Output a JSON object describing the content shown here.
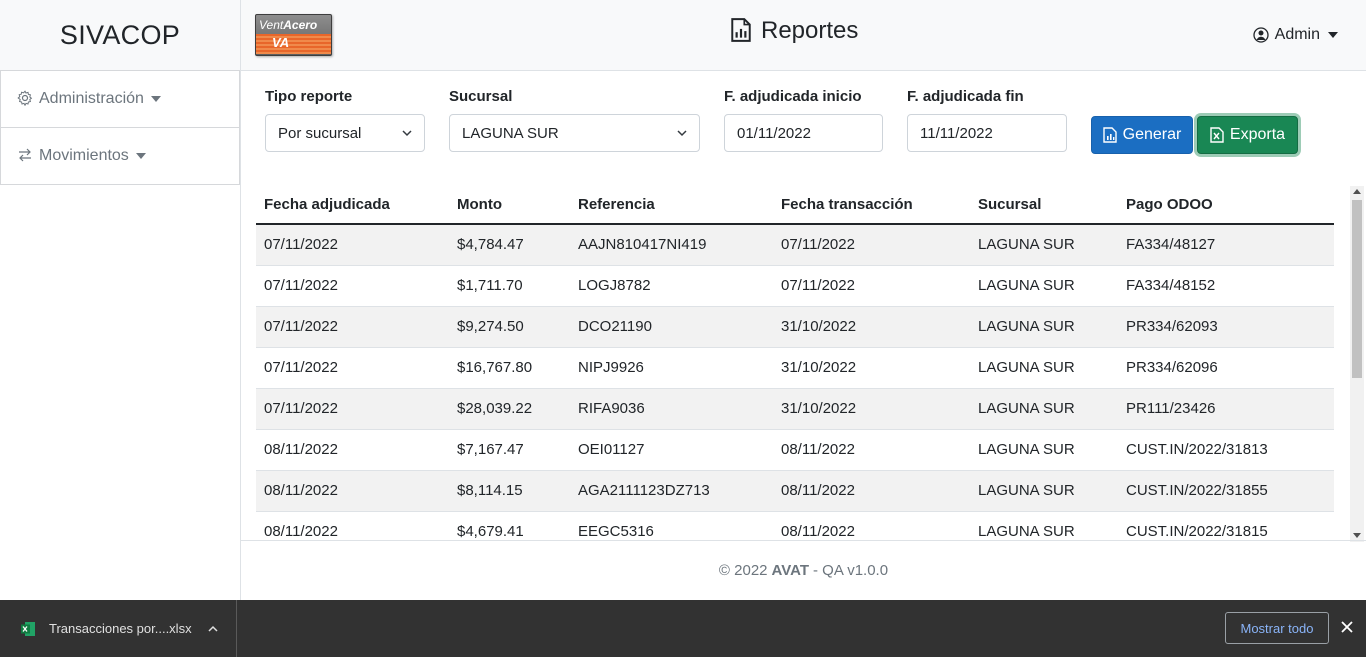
{
  "app": {
    "brand": "SIVACOP",
    "page_title": "Reportes",
    "user": "Admin"
  },
  "logo": {
    "line1_a": "Vent",
    "line1_b": "Acero",
    "line2": "VA"
  },
  "sidebar": {
    "items": [
      {
        "label": "Administración",
        "icon": "gear-icon"
      },
      {
        "label": "Movimientos",
        "icon": "arrows-exchange-icon"
      }
    ]
  },
  "filters": {
    "tipo_reporte": {
      "label": "Tipo reporte",
      "value": "Por sucursal"
    },
    "sucursal": {
      "label": "Sucursal",
      "value": "LAGUNA SUR"
    },
    "inicio": {
      "label": "F. adjudicada inicio",
      "value": "01/11/2022"
    },
    "fin": {
      "label": "F. adjudicada fin",
      "value": "11/11/2022"
    }
  },
  "buttons": {
    "generar": "Generar",
    "exporta": "Exporta"
  },
  "table": {
    "headers": [
      "Fecha adjudicada",
      "Monto",
      "Referencia",
      "Fecha transacción",
      "Sucursal",
      "Pago ODOO"
    ],
    "rows": [
      [
        "07/11/2022",
        "$4,784.47",
        "AAJN810417NI419",
        "07/11/2022",
        "LAGUNA SUR",
        "FA334/48127"
      ],
      [
        "07/11/2022",
        "$1,711.70",
        "LOGJ8782",
        "07/11/2022",
        "LAGUNA SUR",
        "FA334/48152"
      ],
      [
        "07/11/2022",
        "$9,274.50",
        "DCO21190",
        "31/10/2022",
        "LAGUNA SUR",
        "PR334/62093"
      ],
      [
        "07/11/2022",
        "$16,767.80",
        "NIPJ9926",
        "31/10/2022",
        "LAGUNA SUR",
        "PR334/62096"
      ],
      [
        "07/11/2022",
        "$28,039.22",
        "RIFA9036",
        "31/10/2022",
        "LAGUNA SUR",
        "PR111/23426"
      ],
      [
        "08/11/2022",
        "$7,167.47",
        "OEI01127",
        "08/11/2022",
        "LAGUNA SUR",
        "CUST.IN/2022/31813"
      ],
      [
        "08/11/2022",
        "$8,114.15",
        "AGA2111123DZ713",
        "08/11/2022",
        "LAGUNA SUR",
        "CUST.IN/2022/31855"
      ],
      [
        "08/11/2022",
        "$4,679.41",
        "EEGC5316",
        "08/11/2022",
        "LAGUNA SUR",
        "CUST.IN/2022/31815"
      ]
    ]
  },
  "footer": {
    "prefix": "© 2022",
    "company": "AVAT",
    "suffix": "- QA v1.0.0"
  },
  "downloads": {
    "file": "Transacciones por....xlsx",
    "show_all": "Mostrar todo"
  },
  "colors": {
    "primary": "#1b6ec2",
    "success": "#198754",
    "download_bar": "#323232"
  }
}
